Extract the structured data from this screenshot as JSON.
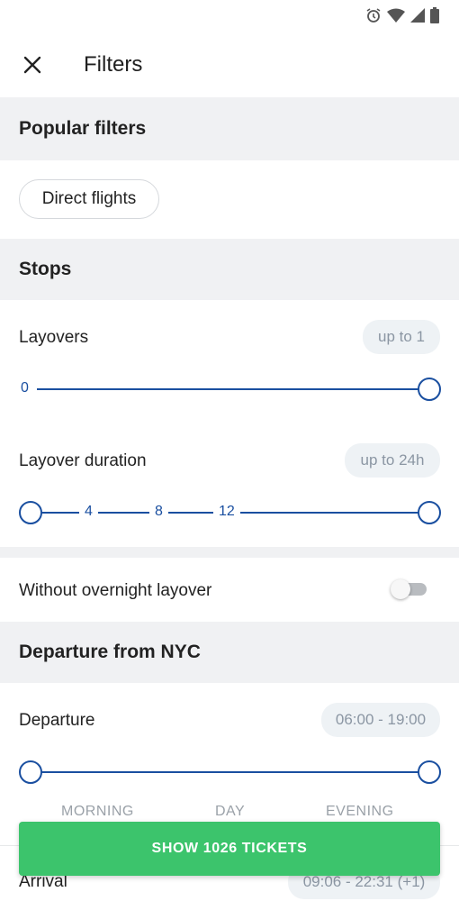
{
  "toolbar": {
    "title": "Filters"
  },
  "popular": {
    "header": "Popular filters",
    "chip_direct": "Direct flights"
  },
  "stops": {
    "header": "Stops",
    "layovers_label": "Layovers",
    "layovers_value": "up to 1",
    "layovers_min_tick": "0",
    "duration_label": "Layover duration",
    "duration_value": "up to 24h",
    "duration_ticks": [
      "4",
      "8",
      "12"
    ]
  },
  "overnight": {
    "label": "Without overnight layover",
    "enabled": false
  },
  "departure_section": {
    "header": "Departure from NYC",
    "departure_label": "Departure",
    "departure_value": "06:00 - 19:00",
    "periods": [
      "MORNING",
      "DAY",
      "EVENING"
    ],
    "arrival_label": "Arrival",
    "arrival_value": "09:06 - 22:31 (+1)"
  },
  "cta": {
    "label": "SHOW 1026 TICKETS"
  },
  "colors": {
    "accent": "#1a4fa0",
    "cta": "#3cc46c",
    "band": "#f0f1f3"
  }
}
